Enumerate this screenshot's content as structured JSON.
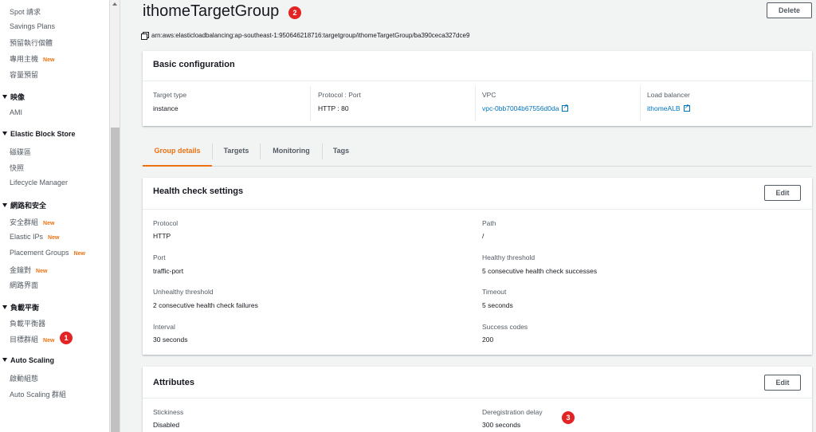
{
  "sidebar": {
    "items": [
      {
        "label": "Spot 請求",
        "type": "item"
      },
      {
        "label": "Savings Plans",
        "type": "item"
      },
      {
        "label": "預留執行個體",
        "type": "item"
      },
      {
        "label": "專用主機",
        "type": "item",
        "badge": "New"
      },
      {
        "label": "容量預留",
        "type": "item"
      },
      {
        "label": "映像",
        "type": "section"
      },
      {
        "label": "AMI",
        "type": "item"
      },
      {
        "label": "Elastic Block Store",
        "type": "section"
      },
      {
        "label": "磁碟區",
        "type": "item"
      },
      {
        "label": "快照",
        "type": "item"
      },
      {
        "label": "Lifecycle Manager",
        "type": "item"
      },
      {
        "label": "網路和安全",
        "type": "section"
      },
      {
        "label": "安全群組",
        "type": "item",
        "badge": "New"
      },
      {
        "label": "Elastic IPs",
        "type": "item",
        "badge": "New"
      },
      {
        "label": "Placement Groups",
        "type": "item",
        "badge": "New"
      },
      {
        "label": "金鑰對",
        "type": "item",
        "badge": "New"
      },
      {
        "label": "網路界面",
        "type": "item"
      },
      {
        "label": "負載平衡",
        "type": "section"
      },
      {
        "label": "負載平衡器",
        "type": "item"
      },
      {
        "label": "目標群組",
        "type": "item",
        "badge": "New"
      },
      {
        "label": "Auto Scaling",
        "type": "section"
      },
      {
        "label": "啟動組態",
        "type": "item"
      },
      {
        "label": "Auto Scaling 群組",
        "type": "item"
      }
    ]
  },
  "markers": [
    "1",
    "2",
    "3"
  ],
  "header": {
    "title": "ithomeTargetGroup",
    "delete_label": "Delete",
    "arn": "arn:aws:elasticloadbalancing:ap-southeast-1:950646218716:targetgroup/ithomeTargetGroup/ba390ceca327dce9"
  },
  "basic_config": {
    "title": "Basic configuration",
    "fields": [
      {
        "label": "Target type",
        "value": "instance"
      },
      {
        "label": "Protocol : Port",
        "value": "HTTP : 80"
      },
      {
        "label": "VPC",
        "value": "vpc-0bb7004b67556d0da"
      },
      {
        "label": "Load balancer",
        "value": "ithomeALB"
      }
    ]
  },
  "tabs": [
    "Group details",
    "Targets",
    "Monitoring",
    "Tags"
  ],
  "health_check": {
    "title": "Health check settings",
    "edit_label": "Edit",
    "fields": [
      {
        "label": "Protocol",
        "value": "HTTP"
      },
      {
        "label": "Path",
        "value": "/"
      },
      {
        "label": "Port",
        "value": "traffic-port"
      },
      {
        "label": "Healthy threshold",
        "value": "5 consecutive health check successes"
      },
      {
        "label": "Unhealthy threshold",
        "value": "2 consecutive health check failures"
      },
      {
        "label": "Timeout",
        "value": "5 seconds"
      },
      {
        "label": "Interval",
        "value": "30 seconds"
      },
      {
        "label": "Success codes",
        "value": "200"
      }
    ]
  },
  "attributes": {
    "title": "Attributes",
    "edit_label": "Edit",
    "fields": [
      {
        "label": "Stickiness",
        "value": "Disabled"
      },
      {
        "label": "Deregistration delay",
        "value": "300 seconds"
      }
    ]
  },
  "colors": {
    "accent": "#ec7211",
    "link": "#0073bb",
    "marker": "#e32424"
  }
}
